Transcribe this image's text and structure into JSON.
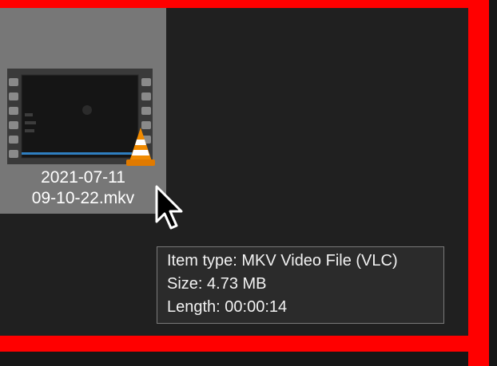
{
  "frame": {
    "highlight_color": "#ff0000"
  },
  "file": {
    "name_line1": "2021-07-11",
    "name_line2": "09-10-22.mkv",
    "thumbnail_icon": "video-film-icon",
    "app_badge_icon": "vlc-cone-icon"
  },
  "tooltip": {
    "item_type": "Item type: MKV Video File (VLC)",
    "size": "Size: 4.73 MB",
    "length": "Length: 00:00:14"
  },
  "cursor": {
    "icon": "mouse-pointer-icon"
  },
  "colors": {
    "background": "#202020",
    "tile_selected": "#777777",
    "tooltip_bg": "#2b2b2b",
    "tooltip_border": "#7a7a7a",
    "text": "#ffffff",
    "vlc_orange": "#f08a00"
  }
}
